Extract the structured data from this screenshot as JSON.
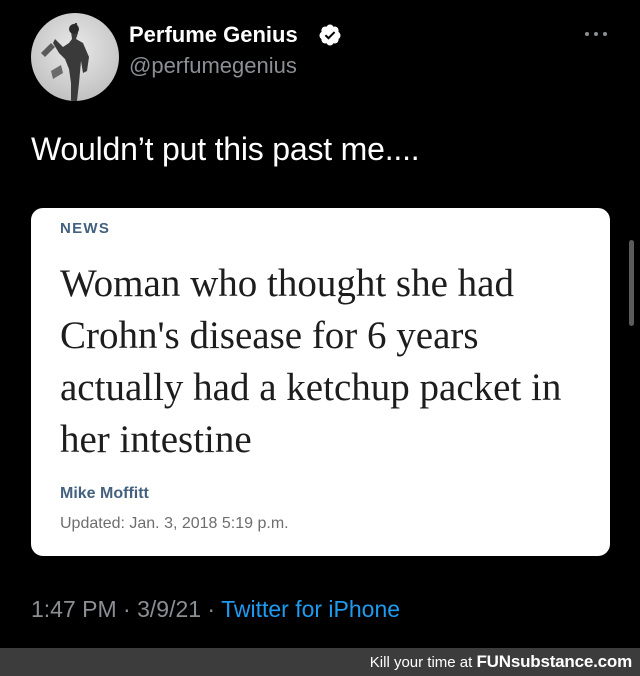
{
  "tweet": {
    "display_name": "Perfume Genius",
    "handle": "@perfumegenius",
    "text": "Wouldn’t put this past me....",
    "time": "1:47 PM · 3/9/21 · ",
    "source": "Twitter for iPhone",
    "verified_color": "#ffffff",
    "link_color": "#1d9bf0"
  },
  "card": {
    "category": "NEWS",
    "headline": "Woman who thought she had Crohn's disease for 6 years actually had a ketchup packet in her intestine",
    "author": "Mike Moffitt",
    "updated": "Updated: Jan. 3, 2018 5:19 p.m.",
    "accent_color": "#44617f"
  },
  "watermark": {
    "prefix": "Kill your time at ",
    "brand": "FUNsubstance.com"
  },
  "icons": {
    "verified": "verified-badge-icon",
    "more": "more-horizontal-icon"
  }
}
